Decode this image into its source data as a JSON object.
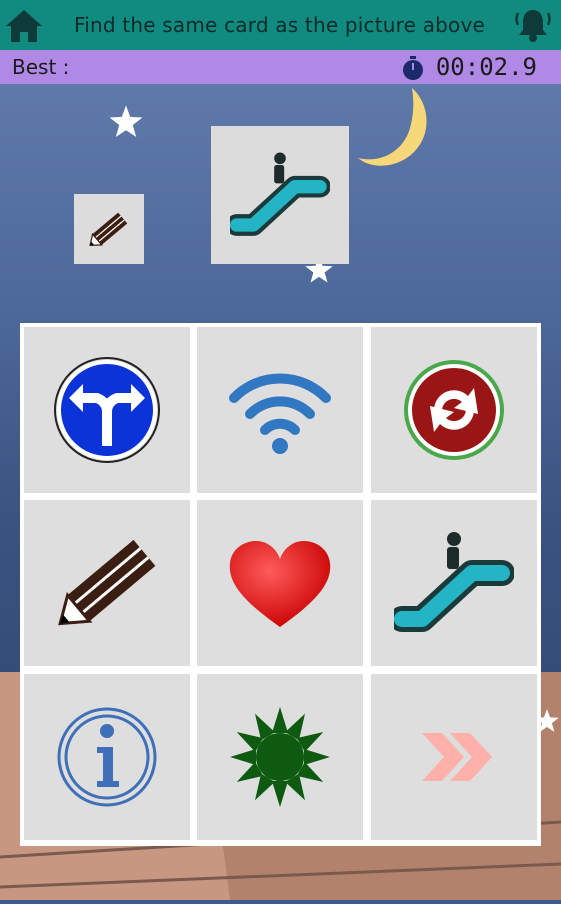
{
  "header": {
    "title": "Find the same card as the picture above",
    "home_icon": "home-icon",
    "bell_icon": "bell-icon"
  },
  "status": {
    "best_label": "Best :",
    "timer": "00:02.9",
    "stopwatch_icon": "stopwatch-icon"
  },
  "target_card": {
    "icon": "escalator-icon"
  },
  "hint_card": {
    "icon": "pencil-icon"
  },
  "cards": [
    {
      "icon": "split-direction-sign-icon"
    },
    {
      "icon": "wifi-icon"
    },
    {
      "icon": "recycle-green-dot-icon"
    },
    {
      "icon": "pencil-icon"
    },
    {
      "icon": "heart-icon"
    },
    {
      "icon": "escalator-icon"
    },
    {
      "icon": "info-icon"
    },
    {
      "icon": "green-sunburst-icon"
    },
    {
      "icon": "double-chevron-right-icon"
    }
  ],
  "colors": {
    "header_bg": "#118a80",
    "best_bar_bg": "#b089e6",
    "sky": "#4b6698",
    "card_bg": "#dedede",
    "escalator": "#23b5c5"
  }
}
